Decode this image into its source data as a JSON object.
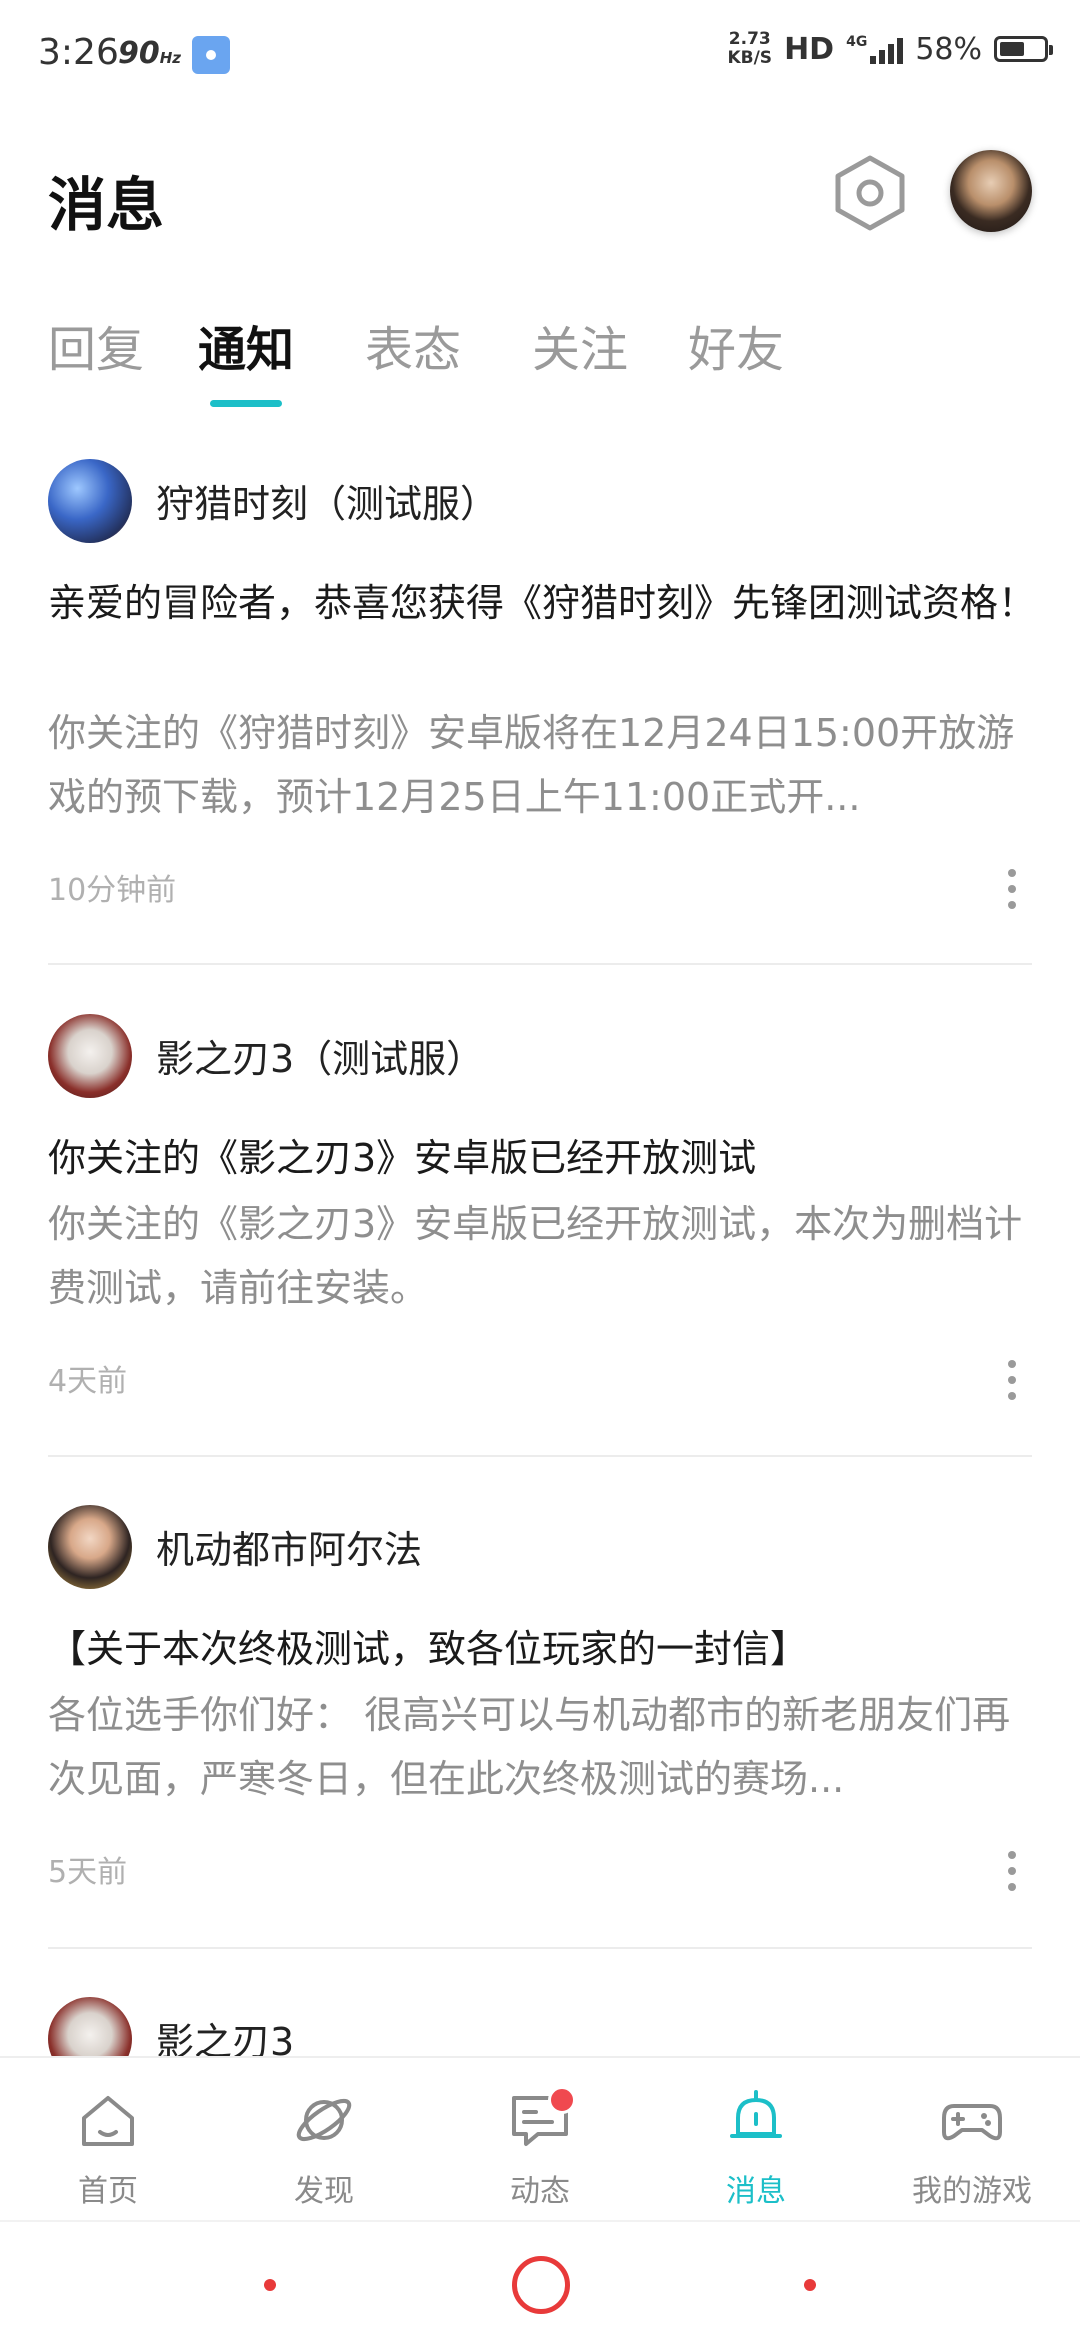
{
  "status_bar": {
    "time": "3:26",
    "refresh_rate": "90",
    "refresh_unit": "Hz",
    "net_speed_value": "2.73",
    "net_speed_unit": "KB/S",
    "hd": "HD",
    "network": "4G",
    "battery": "58%",
    "battery_level": 0.58
  },
  "header": {
    "title": "消息"
  },
  "tabs": [
    {
      "label": "回复",
      "active": false
    },
    {
      "label": "通知",
      "active": true
    },
    {
      "label": "表态",
      "active": false
    },
    {
      "label": "关注",
      "active": false
    },
    {
      "label": "好友",
      "active": false
    }
  ],
  "notifications": [
    {
      "source": "狩猎时刻（测试服）",
      "title": "亲爱的冒险者，恭喜您获得《狩猎时刻》先锋团测试资格！",
      "body": "你关注的《狩猎时刻》安卓版将在12月24日15:00开放游戏的预下载，预计12月25日上午11:00正式开...",
      "time": "10分钟前"
    },
    {
      "source": "影之刃3（测试服）",
      "title": "你关注的《影之刃3》安卓版已经开放测试",
      "body": "你关注的《影之刃3》安卓版已经开放测试，本次为删档计费测试，请前往安装。",
      "time": "4天前"
    },
    {
      "source": "机动都市阿尔法",
      "title": "【关于本次终极测试，致各位玩家的一封信】",
      "body": "各位选手你们好： 很高兴可以与机动都市的新老朋友们再次见面，严寒冬日，但在此次终极测试的赛场...",
      "time": "5天前"
    },
    {
      "source": "影之刃3"
    }
  ],
  "bottom_nav": [
    {
      "label": "首页",
      "icon": "home-icon"
    },
    {
      "label": "发现",
      "icon": "planet-icon"
    },
    {
      "label": "动态",
      "icon": "chat-icon"
    },
    {
      "label": "消息",
      "icon": "bell-icon"
    },
    {
      "label": "我的游戏",
      "icon": "gamepad-icon"
    }
  ],
  "colors": {
    "accent": "#1cbfc8",
    "badge": "#f0494f",
    "system_nav": "#e83a3a"
  }
}
